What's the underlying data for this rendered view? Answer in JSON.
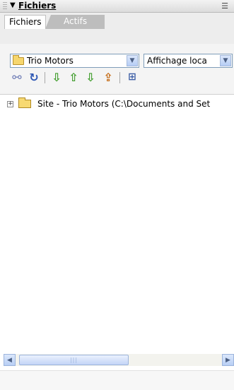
{
  "panel": {
    "title": "Fichiers",
    "collapse_icon": "triangle-down-icon",
    "options_icon": "panel-options-icon"
  },
  "tabs": [
    {
      "label": "Fichiers",
      "active": true
    },
    {
      "label": "Actifs",
      "active": false
    }
  ],
  "site_select": {
    "value": "Trio Motors",
    "icon": "folder-icon"
  },
  "view_select": {
    "value": "Affichage loca"
  },
  "toolbar": {
    "icons": [
      "connect-icon",
      "refresh-icon",
      "get-icon",
      "put-icon",
      "check-out-icon",
      "check-in-icon",
      "expand-view-icon"
    ]
  },
  "tree": [
    {
      "label": "Site - Trio Motors (C:\\Documents and Set",
      "expanded": false,
      "icon": "folder-icon"
    }
  ],
  "scrollbar": {
    "position": 0
  },
  "colors": {
    "accent": "#7f9db9",
    "folder": "#f6d66d",
    "tab_inactive": "#bdbdbd"
  }
}
